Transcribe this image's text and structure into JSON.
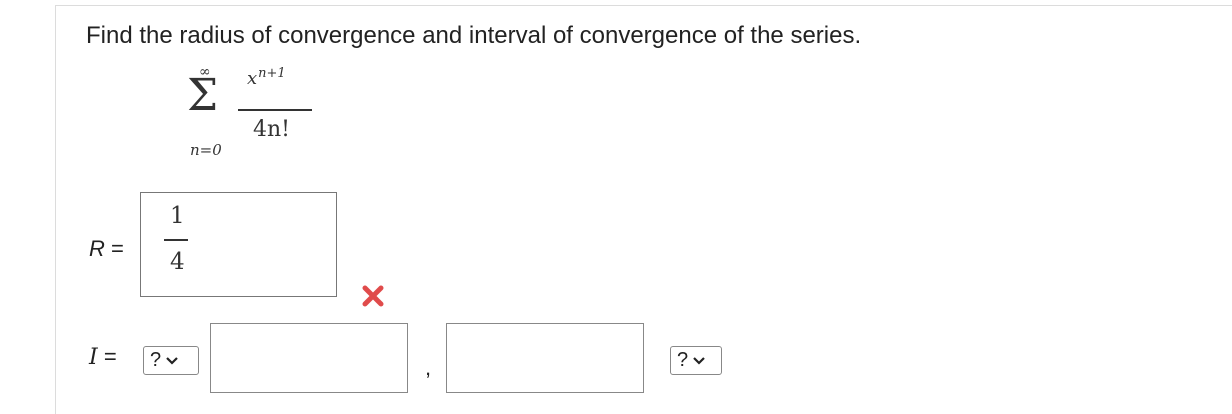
{
  "question": {
    "text": "Find the radius of convergence and interval of convergence of the series."
  },
  "series": {
    "upper_limit": "∞",
    "sigma": "Σ",
    "lower_limit": "n=0",
    "numerator_base": "x",
    "numerator_exponent": "n+1",
    "denominator": "4n!"
  },
  "radius": {
    "label_var": "R",
    "label_eq": " =",
    "answer_numerator": "1",
    "answer_denominator": "4",
    "status": "incorrect",
    "status_color": "#e04b4b"
  },
  "interval": {
    "label_var": "I",
    "label_eq": " =",
    "left_bracket_select": "?",
    "lower_value": "",
    "separator": ",",
    "upper_value": "",
    "right_bracket_select": "?"
  }
}
